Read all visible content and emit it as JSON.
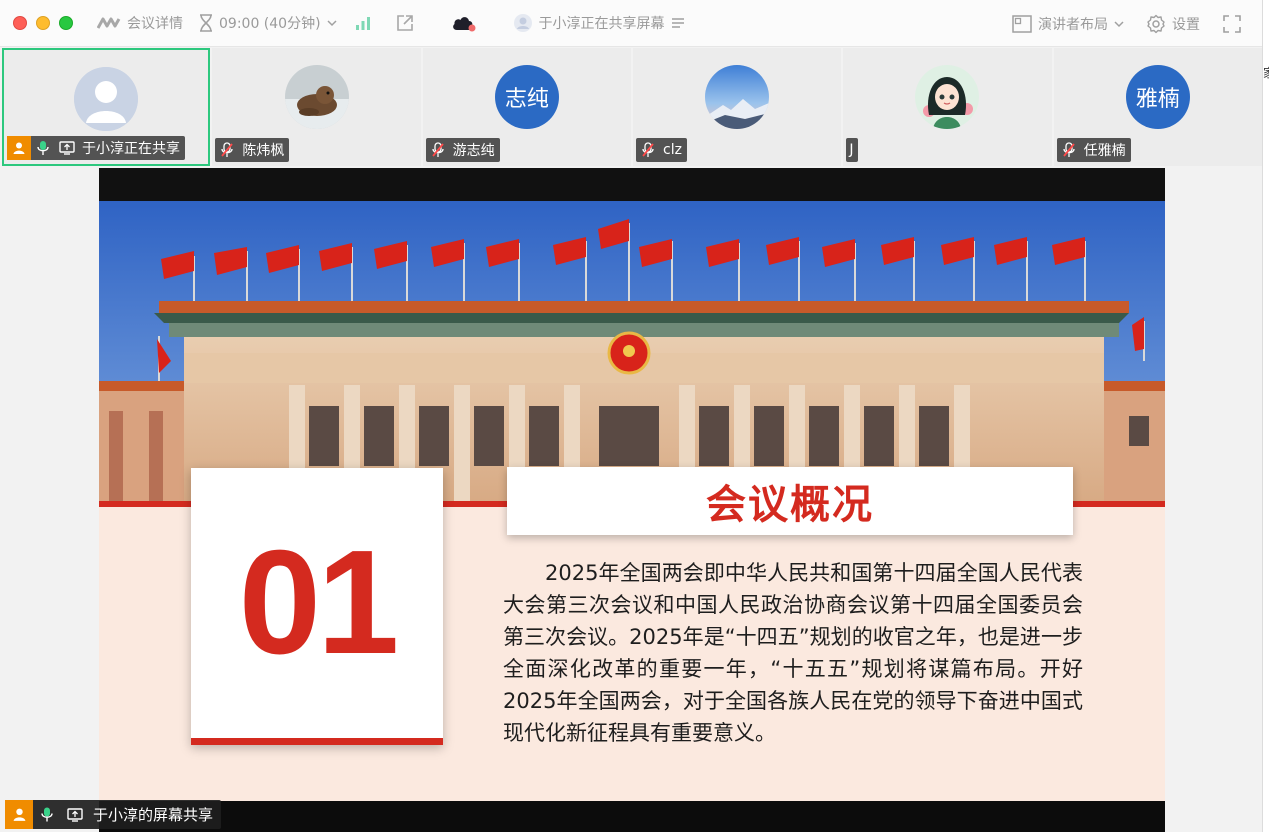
{
  "titlebar": {
    "meeting_details_label": "会议详情",
    "time_label": "09:00 (40分钟)",
    "sharing_status": "于小淳正在共享屏幕",
    "layout_label": "演讲者布局",
    "settings_label": "设置"
  },
  "participants": [
    {
      "name": "于小淳正在共享",
      "avatar": "default-user",
      "is_host": true,
      "sharing": true
    },
    {
      "name": "陈炜枫",
      "avatar": "photo-otter"
    },
    {
      "name": "游志纯",
      "avatar_initials": "志纯"
    },
    {
      "name": "clz",
      "avatar": "photo-mountain"
    },
    {
      "name": "J",
      "avatar": "photo-anime-girl"
    },
    {
      "name": "任雅楠",
      "avatar_initials": "雅楠"
    }
  ],
  "slide": {
    "number": "01",
    "title": "会议概况",
    "body": "2025年全国两会即中华人民共和国第十四届全国人民代表大会第三次会议和中国人民政治协商会议第十四届全国委员会第三次会议。2025年是“十四五”规划的收官之年，也是进一步全面深化改革的重要一年，“十五五”规划将谋篇布局。开好2025年全国两会，对于全国各族人民在党的领导下奋进中国式现代化新征程具有重要意义。"
  },
  "share_label": "于小淳的屏幕共享",
  "edge_char": "家",
  "colors": {
    "accent_green": "#2dc87e",
    "host_orange": "#f08c00",
    "slide_red": "#d42a1f",
    "avatar_blue": "#2b6ac4"
  }
}
